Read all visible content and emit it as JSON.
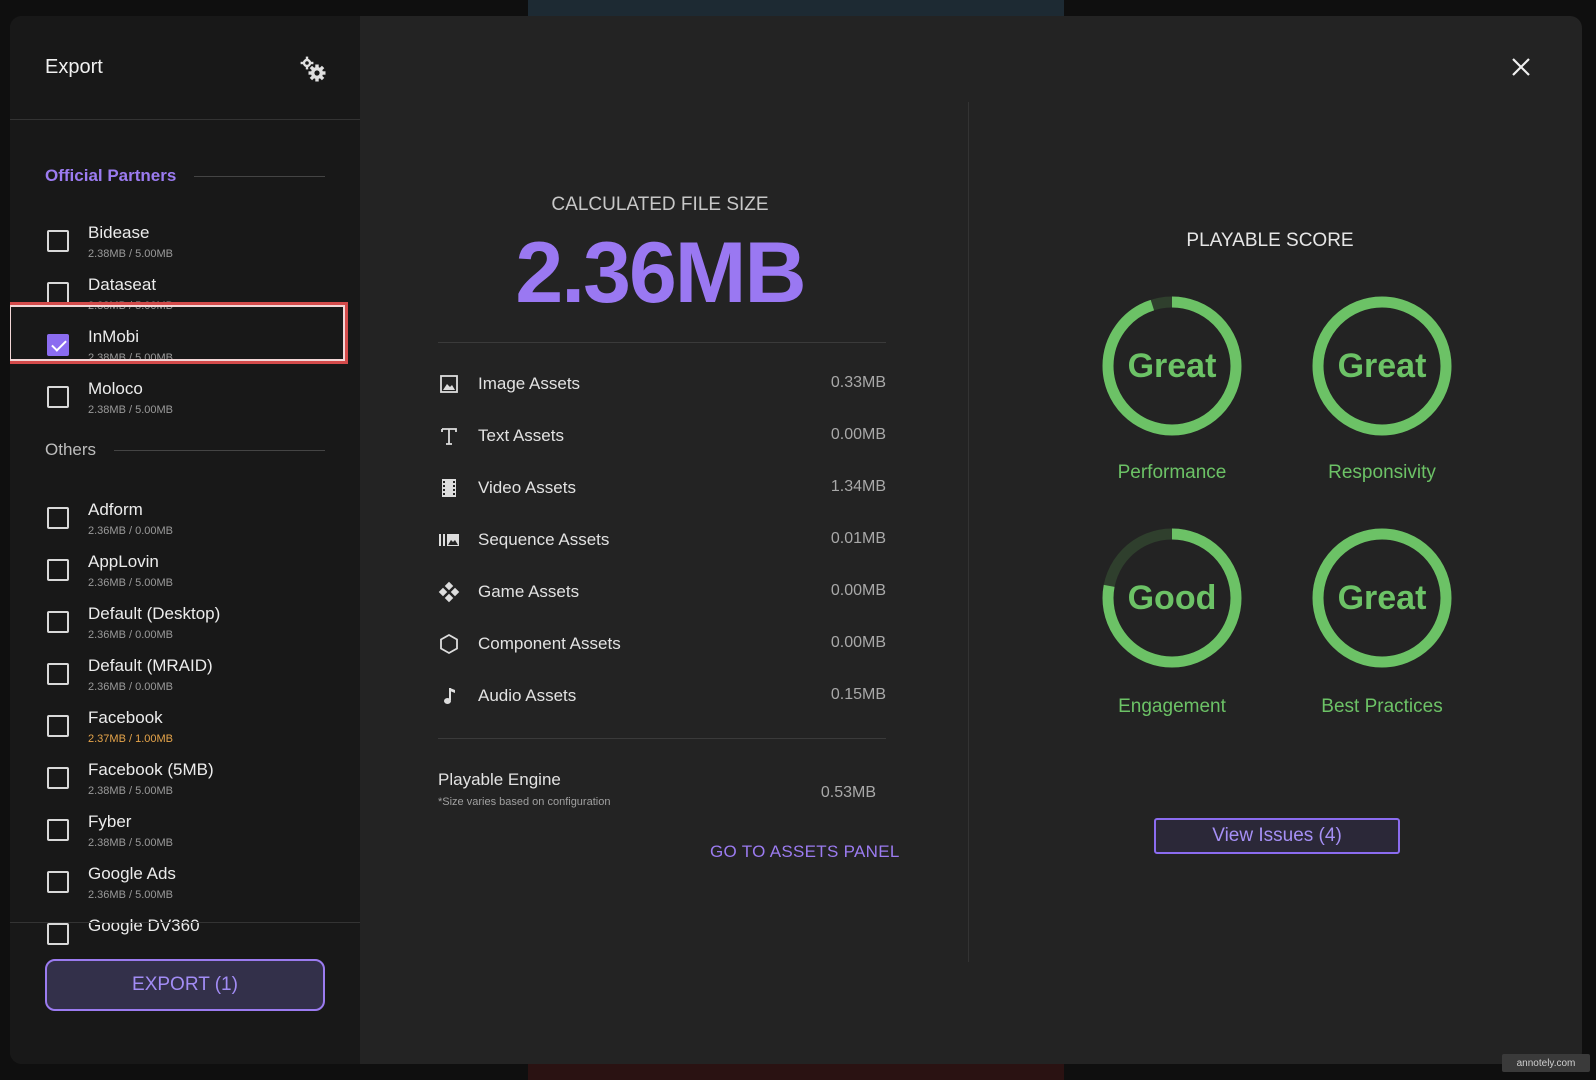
{
  "sidebar": {
    "title": "Export",
    "official_header": "Official Partners",
    "others_header": "Others",
    "official": [
      {
        "name": "Bidease",
        "size": "2.38MB / 5.00MB",
        "checked": false
      },
      {
        "name": "Dataseat",
        "size": "2.38MB / 5.00MB",
        "checked": false
      },
      {
        "name": "InMobi",
        "size": "2.38MB / 5.00MB",
        "checked": true
      },
      {
        "name": "Moloco",
        "size": "2.38MB / 5.00MB",
        "checked": false
      }
    ],
    "others": [
      {
        "name": "Adform",
        "size": "2.36MB / 0.00MB",
        "checked": false
      },
      {
        "name": "AppLovin",
        "size": "2.36MB / 5.00MB",
        "checked": false
      },
      {
        "name": "Default (Desktop)",
        "size": "2.36MB / 0.00MB",
        "checked": false
      },
      {
        "name": "Default (MRAID)",
        "size": "2.36MB / 0.00MB",
        "checked": false
      },
      {
        "name": "Facebook",
        "size": "2.37MB / 1.00MB",
        "checked": false,
        "warning": true
      },
      {
        "name": "Facebook (5MB)",
        "size": "2.38MB / 5.00MB",
        "checked": false
      },
      {
        "name": "Fyber",
        "size": "2.38MB / 5.00MB",
        "checked": false
      },
      {
        "name": "Google Ads",
        "size": "2.36MB / 5.00MB",
        "checked": false
      },
      {
        "name": "Google DV360",
        "size": "",
        "checked": false
      }
    ],
    "export_label": "EXPORT (1)"
  },
  "filesize": {
    "label": "CALCULATED FILE SIZE",
    "value": "2.36MB",
    "assets": [
      {
        "icon": "image-icon",
        "label": "Image Assets",
        "value": "0.33MB"
      },
      {
        "icon": "text-icon",
        "label": "Text Assets",
        "value": "0.00MB"
      },
      {
        "icon": "video-icon",
        "label": "Video Assets",
        "value": "1.34MB"
      },
      {
        "icon": "sequence-icon",
        "label": "Sequence Assets",
        "value": "0.01MB"
      },
      {
        "icon": "game-icon",
        "label": "Game Assets",
        "value": "0.00MB"
      },
      {
        "icon": "component-icon",
        "label": "Component Assets",
        "value": "0.00MB"
      },
      {
        "icon": "audio-icon",
        "label": "Audio Assets",
        "value": "0.15MB"
      }
    ],
    "engine_label": "Playable Engine",
    "engine_note": "*Size varies based on configuration",
    "engine_value": "0.53MB",
    "assets_link": "GO TO ASSETS PANEL"
  },
  "score": {
    "title": "PLAYABLE SCORE",
    "gauges": [
      {
        "name": "Performance",
        "rating": "Great",
        "fraction": 0.95
      },
      {
        "name": "Responsivity",
        "rating": "Great",
        "fraction": 1.0
      },
      {
        "name": "Engagement",
        "rating": "Good",
        "fraction": 0.78
      },
      {
        "name": "Best Practices",
        "rating": "Great",
        "fraction": 1.0
      }
    ],
    "view_issues": "View Issues (4)"
  },
  "colors": {
    "accent": "#9b7bf0",
    "score_green": "#6cc266",
    "score_track": "#2f3f2d",
    "warning": "#e5a44a"
  },
  "watermark": "annotely.com"
}
